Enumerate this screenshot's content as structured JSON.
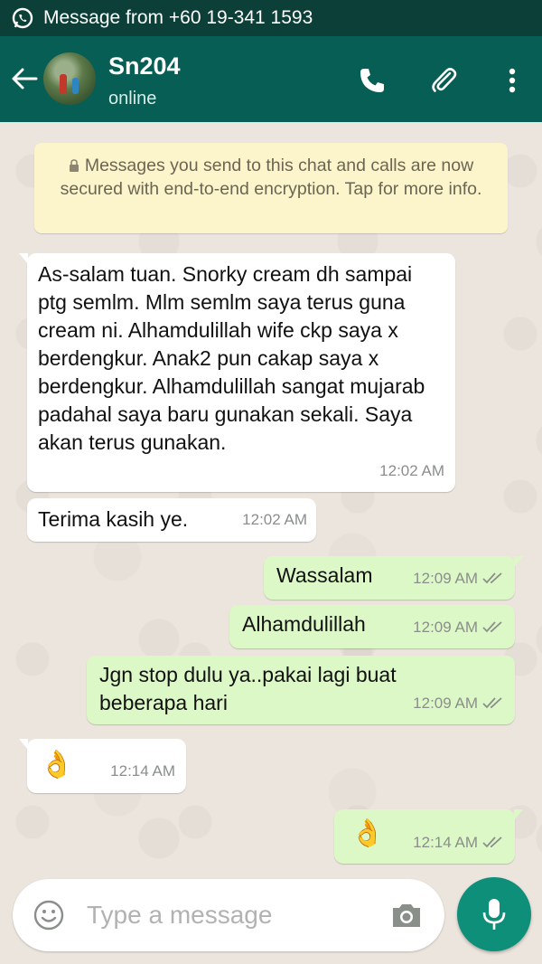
{
  "notification": {
    "text": "Message from +60 19-341 1593",
    "icon": "whatsapp-icon"
  },
  "header": {
    "contact_name": "Sn204",
    "status": "online",
    "icons": [
      "back-arrow-icon",
      "phone-icon",
      "paperclip-icon",
      "more-vert-icon"
    ]
  },
  "encryption_notice": "Messages you send to this chat and calls are now secured with end-to-end encryption. Tap for more info.",
  "messages": [
    {
      "direction": "in",
      "text": "As-salam tuan. Snorky cream dh sampai ptg semlm. Mlm semlm saya terus guna cream ni. Alhamdulillah wife ckp saya x berdengkur. Anak2 pun cakap saya x berdengkur. Alhamdulillah sangat mujarab padahal saya baru gunakan sekali. Saya akan terus gunakan.",
      "time": "12:02 AM"
    },
    {
      "direction": "in",
      "text": "Terima kasih ye.",
      "time": "12:02 AM"
    },
    {
      "direction": "out",
      "text": "Wassalam",
      "time": "12:09 AM"
    },
    {
      "direction": "out",
      "text": "Alhamdulillah",
      "time": "12:09 AM"
    },
    {
      "direction": "out",
      "text": "Jgn stop dulu ya..pakai lagi buat beberapa hari",
      "time": "12:09 AM"
    },
    {
      "direction": "in",
      "text": "👌",
      "time": "12:14 AM"
    },
    {
      "direction": "out",
      "text": "👌",
      "time": "12:14 AM"
    }
  ],
  "composer": {
    "placeholder": "Type a message"
  },
  "colors": {
    "header": "#075e54",
    "notification_bar": "#0b3f38",
    "outgoing": "#dcf8c6",
    "incoming": "#ffffff",
    "mic_button": "#0e8f7a"
  }
}
